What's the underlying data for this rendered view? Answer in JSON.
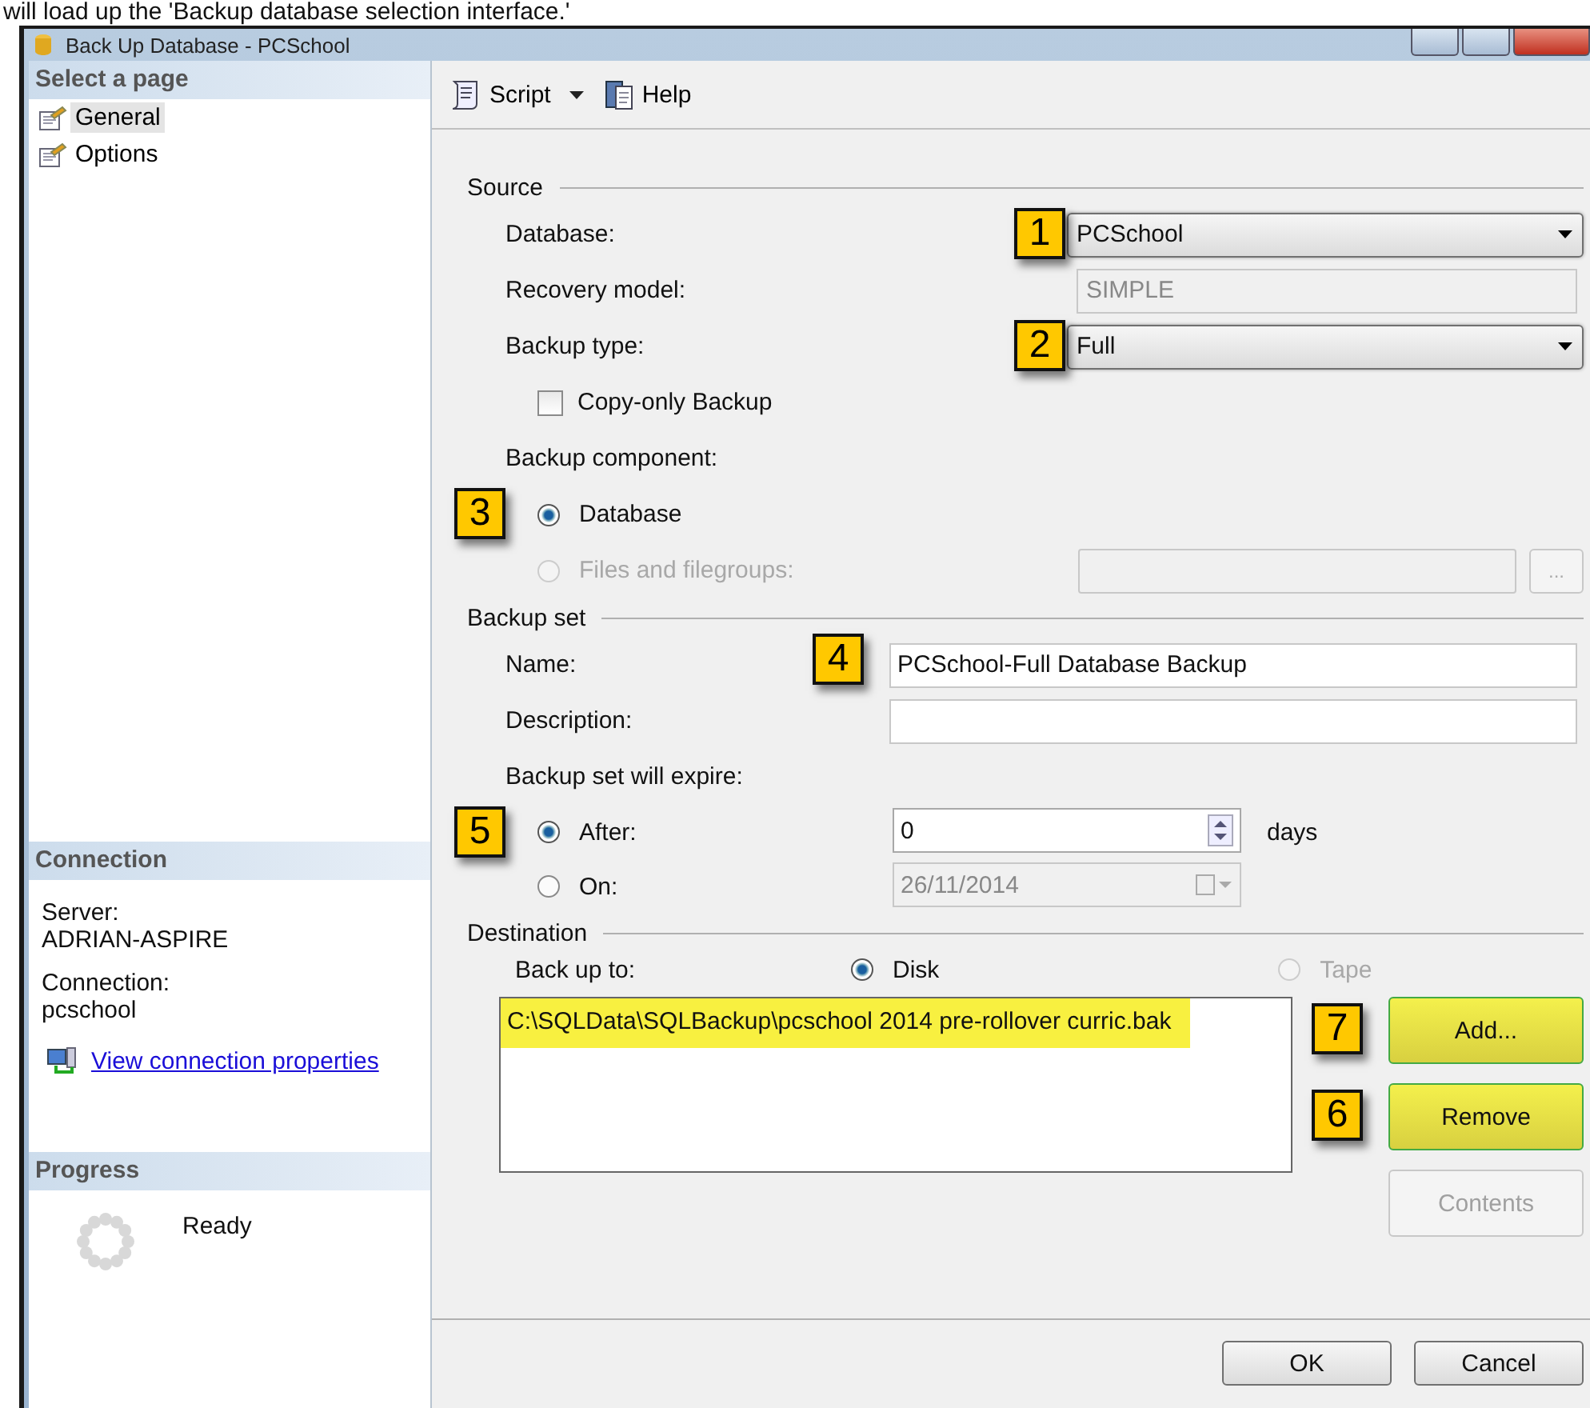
{
  "caption": "will load up the 'Backup database selection interface.'",
  "window": {
    "title": "Back Up Database - PCSchool"
  },
  "sidebar": {
    "select_title": "Select a page",
    "pages": [
      {
        "label": "General",
        "selected": true
      },
      {
        "label": "Options",
        "selected": false
      }
    ],
    "connection_title": "Connection",
    "server_label": "Server:",
    "server": "ADRIAN-ASPIRE",
    "connection_label": "Connection:",
    "connection": "pcschool",
    "link": "View connection properties",
    "progress_title": "Progress",
    "status": "Ready"
  },
  "toolbar": {
    "script": "Script",
    "help": "Help"
  },
  "source": {
    "title": "Source",
    "database_label": "Database:",
    "database": "PCSchool",
    "database_callout": "1",
    "recovery_label": "Recovery model:",
    "recovery": "SIMPLE",
    "type_label": "Backup type:",
    "type": "Full",
    "type_callout": "2",
    "copy_only": {
      "label": "Copy-only Backup",
      "checked": false
    },
    "component_label": "Backup component:",
    "component_callout": "3",
    "components": [
      {
        "label": "Database",
        "selected": true,
        "disabled": false
      },
      {
        "label": "Files and filegroups:",
        "selected": false,
        "disabled": true
      }
    ],
    "browse": "..."
  },
  "backup_set": {
    "title": "Backup set",
    "name_label": "Name:",
    "name": "PCSchool-Full Database Backup",
    "name_callout": "4",
    "description_label": "Description:",
    "expire_label": "Backup set will expire:",
    "expire_callout": "5",
    "expire_options": [
      {
        "label": "After:",
        "selected": true,
        "value": "0",
        "unit": "days"
      },
      {
        "label": "On:",
        "selected": false,
        "value": "26/11/2014"
      }
    ]
  },
  "destination": {
    "title": "Destination",
    "to_label": "Back up to:",
    "media": [
      {
        "label": "Disk",
        "selected": true,
        "disabled": false
      },
      {
        "label": "Tape",
        "selected": false,
        "disabled": true
      }
    ],
    "paths": [
      {
        "path": "C:\\SQLData\\SQLBackup\\pcschool 2014 pre-rollover curric.bak",
        "highlighted": true
      }
    ],
    "buttons": [
      {
        "label": "Add...",
        "callout": "7",
        "highlighted": true,
        "disabled": false
      },
      {
        "label": "Remove",
        "callout": "6",
        "highlighted": true,
        "disabled": false
      },
      {
        "label": "Contents",
        "highlighted": false,
        "disabled": true
      }
    ]
  },
  "footer": {
    "buttons": [
      "OK",
      "Cancel"
    ]
  }
}
